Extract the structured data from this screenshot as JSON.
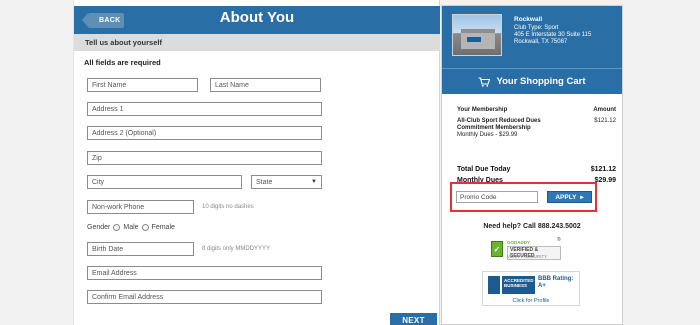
{
  "header": {
    "back_label": "BACK",
    "title": "About You"
  },
  "section": {
    "title": "Tell us about yourself"
  },
  "form": {
    "required_note": "All fields are required",
    "first_name_placeholder": "First Name",
    "last_name_placeholder": "Last Name",
    "address1_placeholder": "Address 1",
    "address2_placeholder": "Address 2 (Optional)",
    "zip_placeholder": "Zip",
    "city_placeholder": "City",
    "state_selected": "State",
    "phone_placeholder": "Non-work Phone",
    "phone_hint": "10 digits no dashes",
    "gender_label": "Gender",
    "gender_male": "Male",
    "gender_female": "Female",
    "birth_placeholder": "Birth Date",
    "birth_hint": "8 digits only MMDDYYYY",
    "email_placeholder": "Email Address",
    "confirm_email_placeholder": "Confirm Email Address",
    "next_label": "NEXT"
  },
  "club": {
    "name": "Rockwall",
    "type": "Club Type: Sport",
    "address1": "405 E Interstate 30 Suite 115",
    "address2": "Rockwall, TX 75087"
  },
  "cart": {
    "title": "Your Shopping Cart",
    "membership_header": "Your Membership",
    "amount_header": "Amount",
    "item_line1": "All-Club Sport Reduced Dues",
    "item_line2": "Commitment Membership",
    "item_line3": "Monthly Dues - $29.99",
    "item_amount": "$121.12",
    "total_label": "Total Due Today",
    "total_value": "$121.12",
    "monthly_label": "Monthly Dues",
    "monthly_value": "$29.99",
    "promo_placeholder": "Promo Code",
    "apply_label": "APPLY"
  },
  "help": {
    "text": "Need help? Call 888.243.5002"
  },
  "seals": {
    "verified_top": "GODADDY",
    "verified_main": "VERIFIED & SECURED",
    "verified_bottom": "VERIFY SECURITY",
    "bbb_accredited": "ACCREDITED BUSINESS",
    "bbb_rating": "BBB Rating:",
    "bbb_grade": "A+",
    "bbb_click": "Click for Profile"
  },
  "colors": {
    "brand_blue": "#2a6ea6",
    "highlight_red": "#e53131"
  }
}
